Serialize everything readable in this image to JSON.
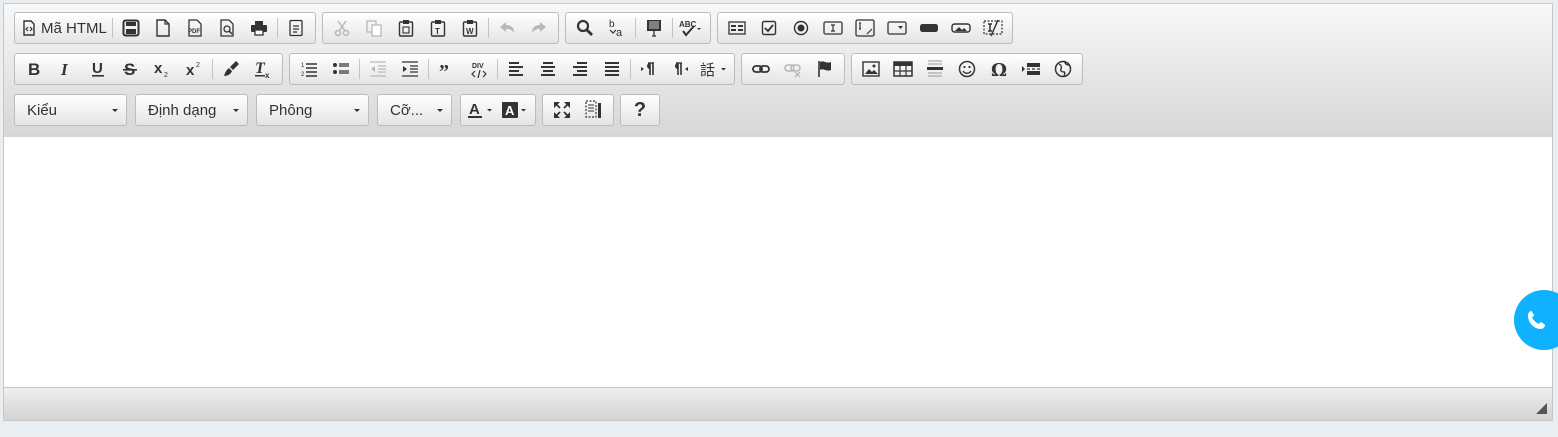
{
  "toolbar": {
    "source_label": "Mã HTML",
    "style_combo": "Kiểu",
    "format_combo": "Định dạng",
    "font_combo": "Phông",
    "size_combo": "Cỡ...",
    "help_label": "?"
  },
  "colors": {
    "toolbar_top": "#f8f8f8",
    "toolbar_bottom": "#d6d6d6",
    "border": "#bcbcbc",
    "icon": "#333333",
    "fab": "#10b2ff"
  }
}
